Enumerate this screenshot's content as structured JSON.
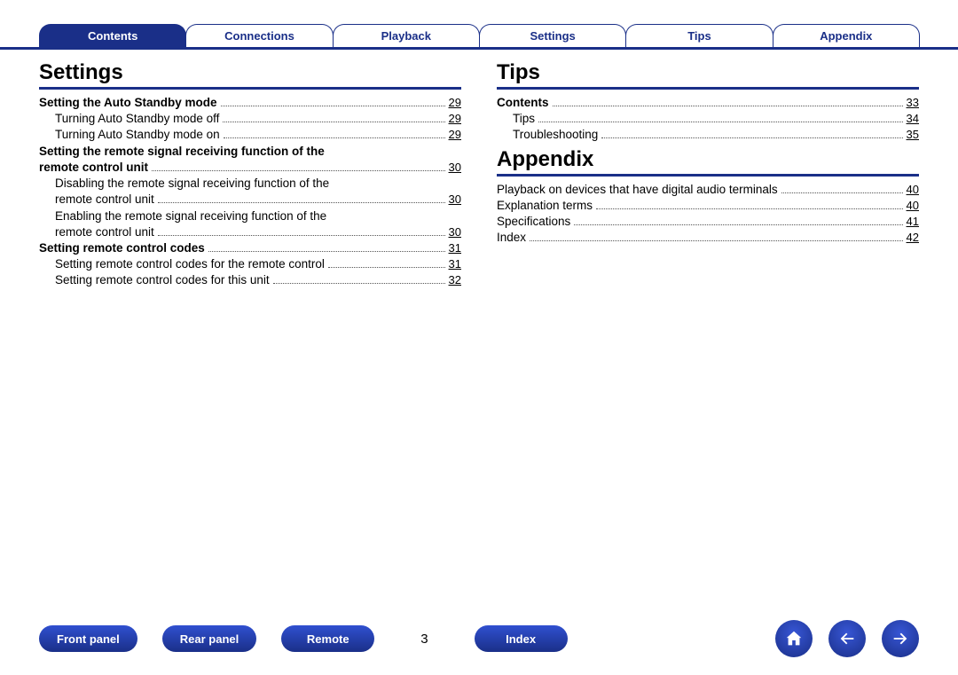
{
  "tabs": [
    {
      "label": "Contents",
      "active": true
    },
    {
      "label": "Connections",
      "active": false
    },
    {
      "label": "Playback",
      "active": false
    },
    {
      "label": "Settings",
      "active": false
    },
    {
      "label": "Tips",
      "active": false
    },
    {
      "label": "Appendix",
      "active": false
    }
  ],
  "left": {
    "heading": "Settings",
    "items": [
      {
        "bold": true,
        "label": "Setting the Auto Standby mode",
        "page": "29"
      },
      {
        "sub": true,
        "label": "Turning Auto Standby mode off",
        "page": "29"
      },
      {
        "sub": true,
        "label": "Turning Auto Standby mode on",
        "page": "29"
      },
      {
        "bold": true,
        "wrap": true,
        "line1": "Setting the remote signal receiving function of the",
        "label": "remote control unit",
        "page": "30"
      },
      {
        "sub": true,
        "wrap": true,
        "line1": "Disabling the remote signal receiving function of the",
        "label": "remote control unit",
        "page": "30"
      },
      {
        "sub": true,
        "wrap": true,
        "line1": "Enabling the remote signal receiving function of the",
        "label": "remote control unit",
        "page": "30"
      },
      {
        "bold": true,
        "label": "Setting remote control codes",
        "page": "31"
      },
      {
        "sub": true,
        "label": "Setting remote control codes for the remote control",
        "page": "31"
      },
      {
        "sub": true,
        "label": "Setting remote control codes for this unit",
        "page": "32"
      }
    ]
  },
  "right": [
    {
      "heading": "Tips",
      "items": [
        {
          "bold": true,
          "label": "Contents",
          "page": "33"
        },
        {
          "sub": true,
          "label": "Tips",
          "page": "34"
        },
        {
          "sub": true,
          "label": "Troubleshooting",
          "page": "35"
        }
      ]
    },
    {
      "heading": "Appendix",
      "items": [
        {
          "label": "Playback on devices that have digital audio terminals",
          "page": "40"
        },
        {
          "label": "Explanation terms",
          "page": "40"
        },
        {
          "label": "Specifications",
          "page": "41"
        },
        {
          "label": "Index",
          "page": "42"
        }
      ]
    }
  ],
  "footer": {
    "buttons": [
      "Front panel",
      "Rear panel",
      "Remote"
    ],
    "page": "3",
    "index": "Index"
  }
}
